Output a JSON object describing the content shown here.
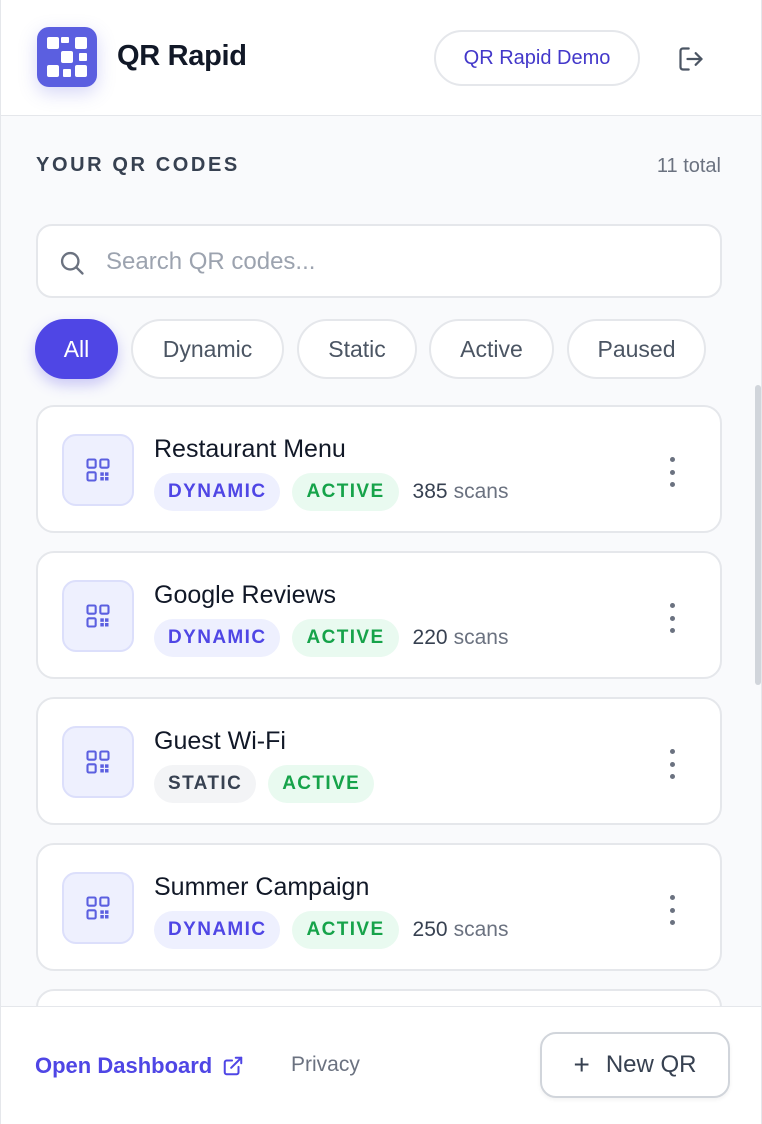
{
  "header": {
    "brand": "QR Rapid",
    "workspace_button": "QR Rapid Demo",
    "logout_icon": "logout-icon"
  },
  "section": {
    "title": "YOUR QR CODES",
    "total": "11 total"
  },
  "search": {
    "placeholder": "Search QR codes...",
    "value": ""
  },
  "filters": [
    {
      "label": "All",
      "selected": true
    },
    {
      "label": "Dynamic",
      "selected": false
    },
    {
      "label": "Static",
      "selected": false
    },
    {
      "label": "Active",
      "selected": false
    },
    {
      "label": "Paused",
      "selected": false
    }
  ],
  "qr_codes": [
    {
      "name": "Restaurant Menu",
      "type": "DYNAMIC",
      "status": "ACTIVE",
      "scans": "385",
      "scans_unit": "scans"
    },
    {
      "name": "Google Reviews",
      "type": "DYNAMIC",
      "status": "ACTIVE",
      "scans": "220",
      "scans_unit": "scans"
    },
    {
      "name": "Guest Wi-Fi",
      "type": "STATIC",
      "status": "ACTIVE",
      "scans": "",
      "scans_unit": ""
    },
    {
      "name": "Summer Campaign",
      "type": "DYNAMIC",
      "status": "ACTIVE",
      "scans": "250",
      "scans_unit": "scans"
    }
  ],
  "footer": {
    "dashboard_link": "Open Dashboard",
    "privacy_link": "Privacy",
    "new_button": "New QR"
  },
  "colors": {
    "accent": "#4f46e5",
    "active_green": "#16a34a",
    "logo": "#5b5fe0"
  }
}
